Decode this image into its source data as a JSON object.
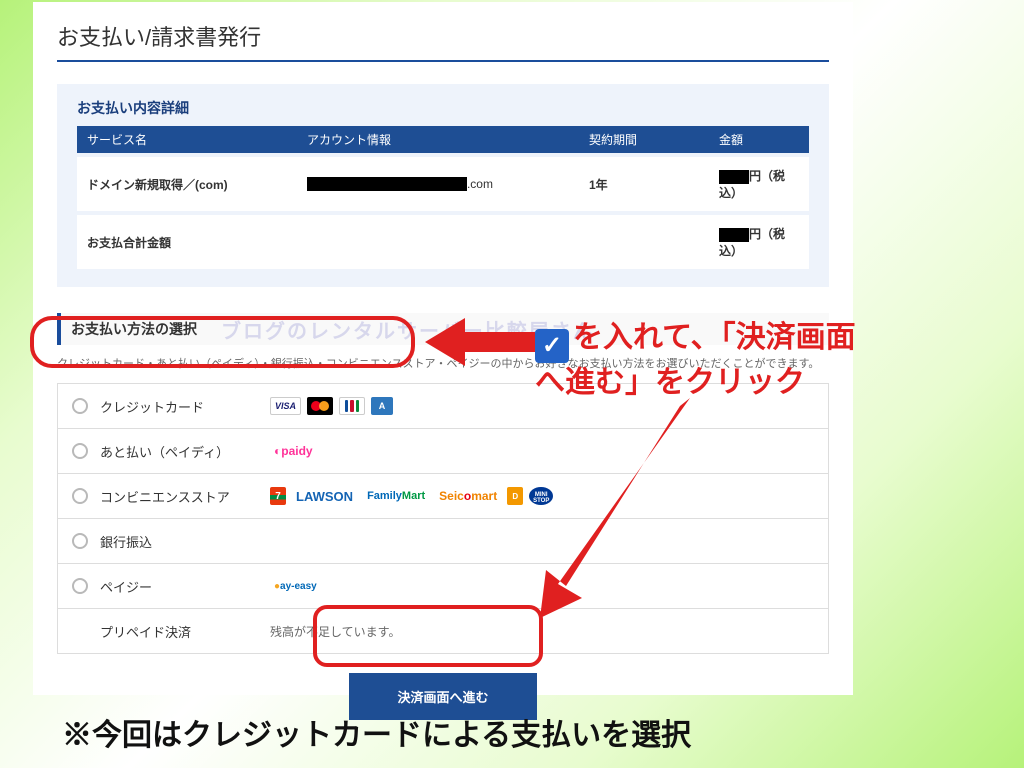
{
  "page": {
    "title": "お支払い/請求書発行"
  },
  "details": {
    "heading": "お支払い内容詳細",
    "columns": {
      "service": "サービス名",
      "account": "アカウント情報",
      "period": "契約期間",
      "amount": "金額"
    },
    "rows": [
      {
        "service": "ドメイン新規取得／(com)",
        "account_suffix": ".com",
        "period": "1年",
        "amount_suffix": "円（税込）"
      }
    ],
    "total_label": "お支払合計金額",
    "total_suffix": "円（税込）"
  },
  "method": {
    "heading": "お支払い方法の選択",
    "watermark": "ブログのレンタルサーバー比較屋さん",
    "description": "クレジットカード・あと払い（ペイディ）・銀行振込・コンビニエンスストア・ペイジーの中からお好きなお支払い方法をお選びいただくことができます。",
    "options": {
      "credit": "クレジットカード",
      "paidy": "あと払い（ペイディ）",
      "cvs": "コンビニエンスストア",
      "bank": "銀行振込",
      "payeasy": "ペイジー",
      "prepaid": "プリペイド決済"
    },
    "prepaid_note": "残高が不足しています。",
    "logos": {
      "visa": "VISA",
      "jcb": "JCB",
      "amex": "A",
      "paidy": "paidy",
      "seven": "7",
      "lawson": "LAWSON",
      "familymart_a": "Family",
      "familymart_b": "Mart",
      "seico_a": "Seic",
      "seico_b": "o",
      "seico_c": "mart",
      "daily": "D",
      "ministop": "MINI STOP",
      "payeasy": "ay-easy"
    }
  },
  "submit": {
    "label": "決済画面へ進む"
  },
  "annotations": {
    "callout_line1_tail": "を入れて、「決済画面",
    "callout_line2": "へ進む」をクリック",
    "footnote": "※今回はクレジットカードによる支払いを選択"
  }
}
